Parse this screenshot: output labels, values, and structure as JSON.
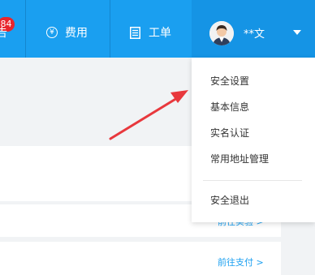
{
  "header": {
    "bg_color": "#1a9ff0",
    "notice": {
      "badge_count": "84",
      "label_fragment": "告"
    },
    "fee": {
      "icon": "yen-circle-icon",
      "label": "费用"
    },
    "workorder": {
      "icon": "document-list-icon",
      "label": "工单"
    },
    "user": {
      "name": "**文",
      "avatar_icon": "user-avatar-icon",
      "caret_icon": "caret-down-icon"
    }
  },
  "content": {
    "link_partial": "前往实验 >",
    "link_pay": "前往支付 >",
    "link_color": "#1a9ff0"
  },
  "user_menu": {
    "items": [
      {
        "label": "安全设置"
      },
      {
        "label": "基本信息"
      },
      {
        "label": "实名认证"
      },
      {
        "label": "常用地址管理"
      }
    ],
    "logout": "安全退出"
  },
  "annotation": {
    "type": "red-arrow",
    "color": "#e8383d",
    "points_to": "安全设置"
  }
}
